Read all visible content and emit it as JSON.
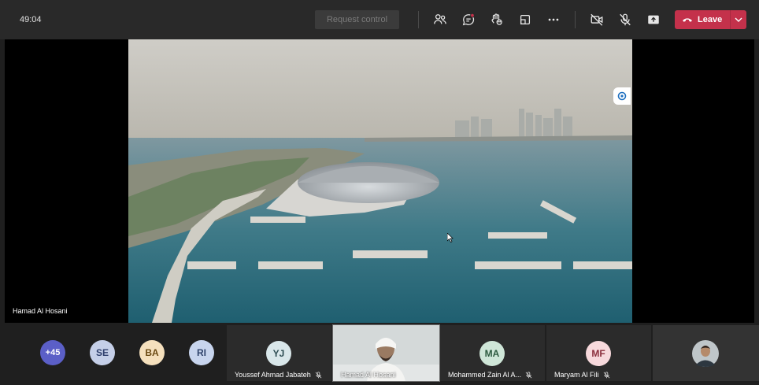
{
  "meeting": {
    "timer": "49:04",
    "request_control_label": "Request control",
    "leave_label": "Leave"
  },
  "toolbar_icons": [
    "people-icon",
    "chat-icon",
    "reactions-icon",
    "rooms-icon",
    "more-icon",
    "camera-off-icon",
    "mic-off-icon",
    "share-icon"
  ],
  "stage": {
    "presenter_name": "Hamad Al Hosani"
  },
  "overflow": {
    "count_label": "+45"
  },
  "small_avatars": [
    {
      "initials": "SE",
      "bg": "#c5cfe8",
      "fg": "#2f3f6c"
    },
    {
      "initials": "BA",
      "bg": "#f5e0bd",
      "fg": "#6b4a13"
    },
    {
      "initials": "RI",
      "bg": "#c8d5ee",
      "fg": "#30446c"
    }
  ],
  "participants": [
    {
      "name": "Youssef Ahmad Jabateh",
      "initials": "YJ",
      "bg": "#d9e7ea",
      "fg": "#2e4d53",
      "muted": true
    },
    {
      "name": "Hamad Al Hosani",
      "video": true,
      "muted": false
    },
    {
      "name": "Mohammed Zain Al A...",
      "initials": "MA",
      "bg": "#cfe6d8",
      "fg": "#2c5a3f",
      "muted": true
    },
    {
      "name": "Maryam Al Fili",
      "initials": "MF",
      "bg": "#f7d9dc",
      "fg": "#8a2e3c",
      "muted": true
    }
  ],
  "colors": {
    "leave": "#c4314b",
    "overflow": "#5b5fc7"
  }
}
